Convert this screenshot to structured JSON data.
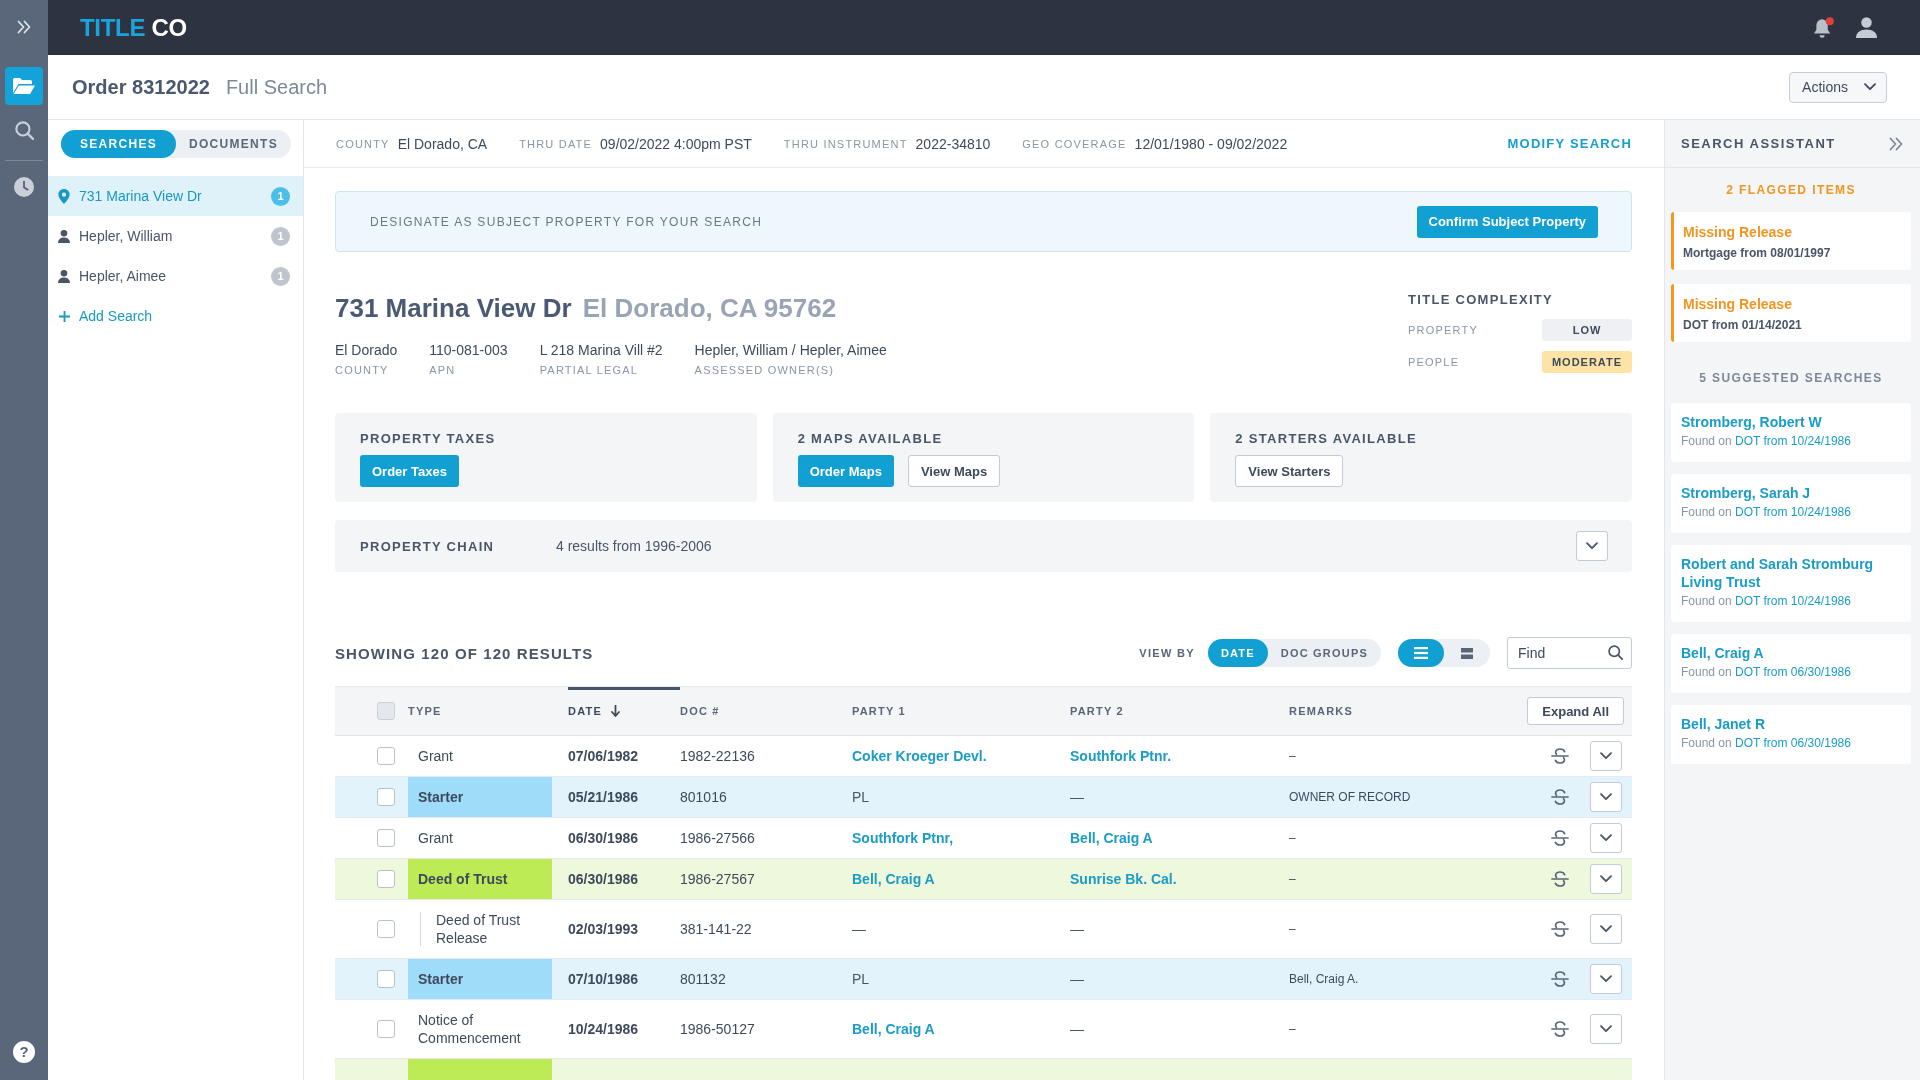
{
  "rail": {
    "items": [
      {
        "selected": true
      },
      {
        "selected": false
      },
      {
        "selected": false
      }
    ],
    "help": "?"
  },
  "header": {
    "logo": {
      "accent": "TITLE",
      "rest": "CO"
    },
    "notifications_unread": true
  },
  "order": {
    "title": "Order 8312022",
    "subtitle": "Full Search",
    "actions": "Actions"
  },
  "search_tabs": [
    {
      "label": "SEARCHES",
      "selected": true
    },
    {
      "label": "DOCUMENTS",
      "selected": false
    }
  ],
  "searches": [
    {
      "kind": "property",
      "label": "731 Marina View Dr",
      "count": "1",
      "selected": true
    },
    {
      "kind": "person",
      "label": "Hepler, William",
      "count": "1",
      "selected": false
    },
    {
      "kind": "person",
      "label": "Hepler, Aimee",
      "count": "1",
      "selected": false
    }
  ],
  "add_search": "Add Search",
  "criteria": {
    "items": [
      {
        "label": "COUNTY",
        "value": "El Dorado, CA"
      },
      {
        "label": "THRU DATE",
        "value": "09/02/2022 4:00pm PST"
      },
      {
        "label": "THRU INSTRUMENT",
        "value": "2022-34810"
      },
      {
        "label": "GEO COVERAGE",
        "value": "12/01/1980 - 09/02/2022"
      }
    ],
    "modify": "MODIFY SEARCH"
  },
  "banner": {
    "text": "DESIGNATE AS SUBJECT PROPERTY FOR YOUR SEARCH",
    "button": "Confirm Subject Property"
  },
  "property": {
    "address": "731 Marina View Dr",
    "locality": "El Dorado, CA 95762",
    "facts": [
      {
        "value": "El Dorado",
        "label": "COUNTY"
      },
      {
        "value": "110-081-003",
        "label": "APN"
      },
      {
        "value": "L 218 Marina Vill #2",
        "label": "PARTIAL LEGAL"
      },
      {
        "value": "Hepler, William / Hepler, Aimee",
        "label": "ASSESSED OWNER(S)"
      }
    ],
    "complexity": {
      "title": "TITLE COMPLEXITY",
      "rows": [
        {
          "label": "PROPERTY",
          "rating": "LOW",
          "color": "#eef0f3"
        },
        {
          "label": "PEOPLE",
          "rating": "MODERATE",
          "color": "#fde4a4"
        }
      ]
    }
  },
  "services": [
    {
      "title": "PROPERTY TAXES",
      "buttons": [
        {
          "label": "Order Taxes",
          "kind": "primary"
        }
      ]
    },
    {
      "title": "2 MAPS AVAILABLE",
      "buttons": [
        {
          "label": "Order Maps",
          "kind": "primary"
        },
        {
          "label": "View Maps",
          "kind": "secondary"
        }
      ]
    },
    {
      "title": "2 STARTERS AVAILABLE",
      "buttons": [
        {
          "label": "View Starters",
          "kind": "secondary"
        }
      ]
    }
  ],
  "property_chain": {
    "title": "PROPERTY CHAIN",
    "summary": "4 results from 1996-2006",
    "expanded": false
  },
  "results": {
    "summary": "SHOWING 120 OF 120 RESULTS",
    "view_by_label": "VIEW BY",
    "view_by": [
      {
        "label": "DATE",
        "selected": true
      },
      {
        "label": "DOC GROUPS",
        "selected": false
      }
    ],
    "layouts": [
      {
        "selected": true
      },
      {
        "selected": false
      }
    ],
    "find_placeholder": "Find"
  },
  "table": {
    "select_all_checked": false,
    "columns": [
      {
        "label": "TYPE",
        "sorted": false
      },
      {
        "label": "DATE",
        "sorted": true
      },
      {
        "label": "DOC #",
        "sorted": false
      },
      {
        "label": "PARTY 1",
        "sorted": false
      },
      {
        "label": "PARTY 2",
        "sorted": false
      },
      {
        "label": "REMARKS",
        "sorted": false
      }
    ],
    "expand_all": "Expand All",
    "rows": [
      {
        "kind": "plain",
        "checked": false,
        "type": "Grant",
        "date": "07/06/1982",
        "doc": "1982-22136",
        "party_1": {
          "text": "Coker Kroeger Devl.",
          "link": true
        },
        "party_2": {
          "text": "Southfork Ptnr.",
          "link": true
        },
        "remarks": "–"
      },
      {
        "kind": "starter",
        "checked": false,
        "type": "Starter",
        "date": "05/21/1986",
        "doc": "801016",
        "party_1": {
          "text": "PL",
          "link": false
        },
        "party_2": {
          "text": "—",
          "link": false
        },
        "remarks": "OWNER OF RECORD"
      },
      {
        "kind": "plain",
        "checked": false,
        "type": "Grant",
        "date": "06/30/1986",
        "doc": "1986-27566",
        "party_1": {
          "text": "Southfork Ptnr,",
          "link": true
        },
        "party_2": {
          "text": "Bell, Craig A",
          "link": true
        },
        "remarks": "–"
      },
      {
        "kind": "deed_of_trust",
        "checked": false,
        "type": "Deed of Trust",
        "date": "06/30/1986",
        "doc": "1986-27567",
        "party_1": {
          "text": "Bell, Craig A",
          "link": true
        },
        "party_2": {
          "text": "Sunrise Bk. Cal.",
          "link": true
        },
        "remarks": "–",
        "children": [
          {
            "kind": "plain",
            "checked": false,
            "type": "Deed of Trust Release",
            "date": "02/03/1993",
            "doc": "381-141-22",
            "party_1": {
              "text": "—",
              "link": false
            },
            "party_2": {
              "text": "—",
              "link": false
            },
            "remarks": "–"
          }
        ]
      },
      {
        "kind": "starter",
        "checked": false,
        "type": "Starter",
        "date": "07/10/1986",
        "doc": "801132",
        "party_1": {
          "text": "PL",
          "link": false
        },
        "party_2": {
          "text": "—",
          "link": false
        },
        "remarks": "Bell, Craig A."
      },
      {
        "kind": "plain",
        "checked": false,
        "type": "Notice of Commencement",
        "date": "10/24/1986",
        "doc": "1986-50127",
        "party_1": {
          "text": "Bell, Craig A",
          "link": true
        },
        "party_2": {
          "text": "—",
          "link": false
        },
        "remarks": "–"
      }
    ],
    "cut_off_row": {
      "kind": "deed_of_trust"
    }
  },
  "assistant": {
    "title": "SEARCH ASSISTANT",
    "flagged_heading": "2 FLAGGED ITEMS",
    "flagged": [
      {
        "title": "Missing Release",
        "detail": "Mortgage from 08/01/1997"
      },
      {
        "title": "Missing Release",
        "detail": "DOT from 01/14/2021"
      }
    ],
    "suggested_heading": "5 SUGGESTED SEARCHES",
    "suggestions": [
      {
        "name": "Stromberg, Robert W",
        "found_prefix": "Found on",
        "document": "DOT from 10/24/1986"
      },
      {
        "name": "Stromberg, Sarah J",
        "found_prefix": "Found on",
        "document": "DOT from 10/24/1986"
      },
      {
        "name": "Robert and Sarah Stromburg Living Trust",
        "found_prefix": "Found on",
        "document": "DOT from 10/24/1986"
      },
      {
        "name": "Bell, Craig A",
        "found_prefix": "Found on",
        "document": "DOT from 06/30/1986"
      },
      {
        "name": "Bell, Janet R",
        "found_prefix": "Found on",
        "document": "DOT from 06/30/1986"
      }
    ]
  }
}
